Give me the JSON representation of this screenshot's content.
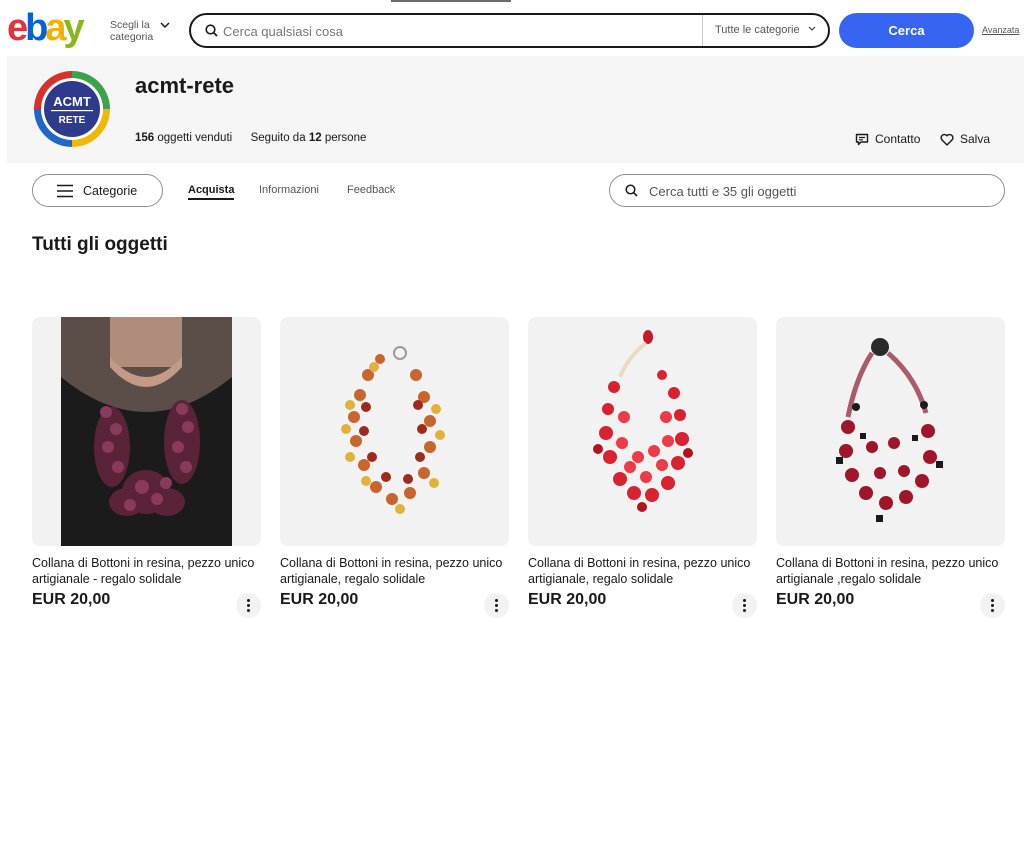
{
  "header": {
    "category_picker": [
      "Scegli la",
      "categoria"
    ],
    "search_placeholder": "Cerca qualsiasi cosa",
    "category_select": "Tutte le categorie",
    "search_button": "Cerca",
    "advanced_link": "Avanzata"
  },
  "store": {
    "name": "acmt-rete",
    "logo_text": [
      "ACMT",
      "RETE"
    ],
    "sold_count": "156",
    "sold_label": "oggetti venduti",
    "followers_prefix": "Seguito da",
    "followers_count": "12",
    "followers_suffix": "persone",
    "contact_label": "Contatto",
    "save_label": "Salva"
  },
  "nav": {
    "categories_button": "Categorie",
    "tabs": [
      "Acquista",
      "Informazioni",
      "Feedback"
    ],
    "store_search_placeholder": "Cerca tutti e 35 gli oggetti"
  },
  "section_title": "Tutti gli oggetti",
  "products": [
    {
      "title": "Collana di Bottoni in resina, pezzo unico artigianale - regalo solidale",
      "price": "EUR 20,00"
    },
    {
      "title": "Collana di Bottoni in resina, pezzo unico artigianale, regalo solidale",
      "price": "EUR 20,00"
    },
    {
      "title": "Collana di Bottoni in resina, pezzo unico artigianale, regalo solidale",
      "price": "EUR 20,00"
    },
    {
      "title": "Collana di Bottoni in resina, pezzo unico artigianale ,regalo solidale",
      "price": "EUR 20,00"
    }
  ],
  "colors": {
    "accent": "#3665f3",
    "ebay_e": "#e53238",
    "ebay_b": "#0064d2",
    "ebay_a": "#f5af02",
    "ebay_y": "#86b817"
  }
}
